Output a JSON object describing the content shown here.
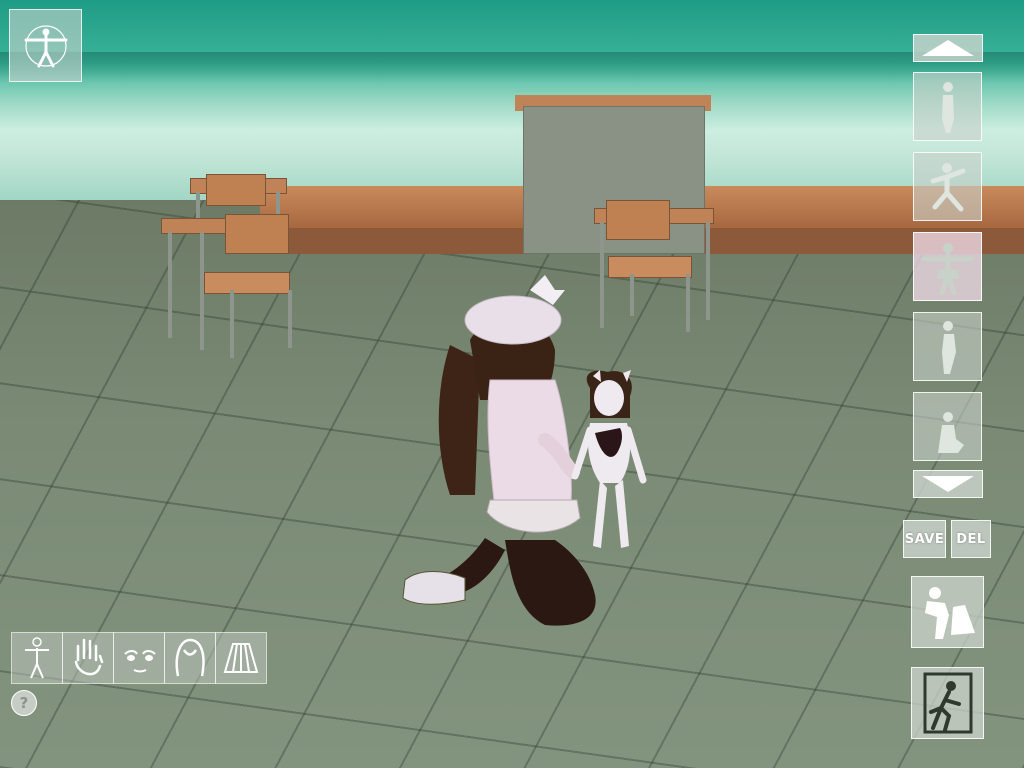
{
  "toolbar": {
    "pose_icon": "vitruvian-figure-icon",
    "save_label": "SAVE",
    "delete_label": "DEL",
    "help_label": "?"
  },
  "pose_slots": [
    {
      "icon": "standing-pose-icon",
      "selected": false
    },
    {
      "icon": "running-pose-icon",
      "selected": false
    },
    {
      "icon": "t-pose-icon",
      "selected": true
    },
    {
      "icon": "side-standing-pose-icon",
      "selected": false
    },
    {
      "icon": "sitting-pose-icon",
      "selected": false
    }
  ],
  "edit_tools": [
    {
      "icon": "body-icon"
    },
    {
      "icon": "hand-icon"
    },
    {
      "icon": "face-icon"
    },
    {
      "icon": "hair-icon"
    },
    {
      "icon": "skirt-icon"
    }
  ],
  "actions": {
    "undress_icon": "undress-icon",
    "exit_icon": "exit-icon"
  },
  "colors": {
    "accent_pink": "#ead6e3",
    "ui_panel": "#cdd4ce"
  }
}
